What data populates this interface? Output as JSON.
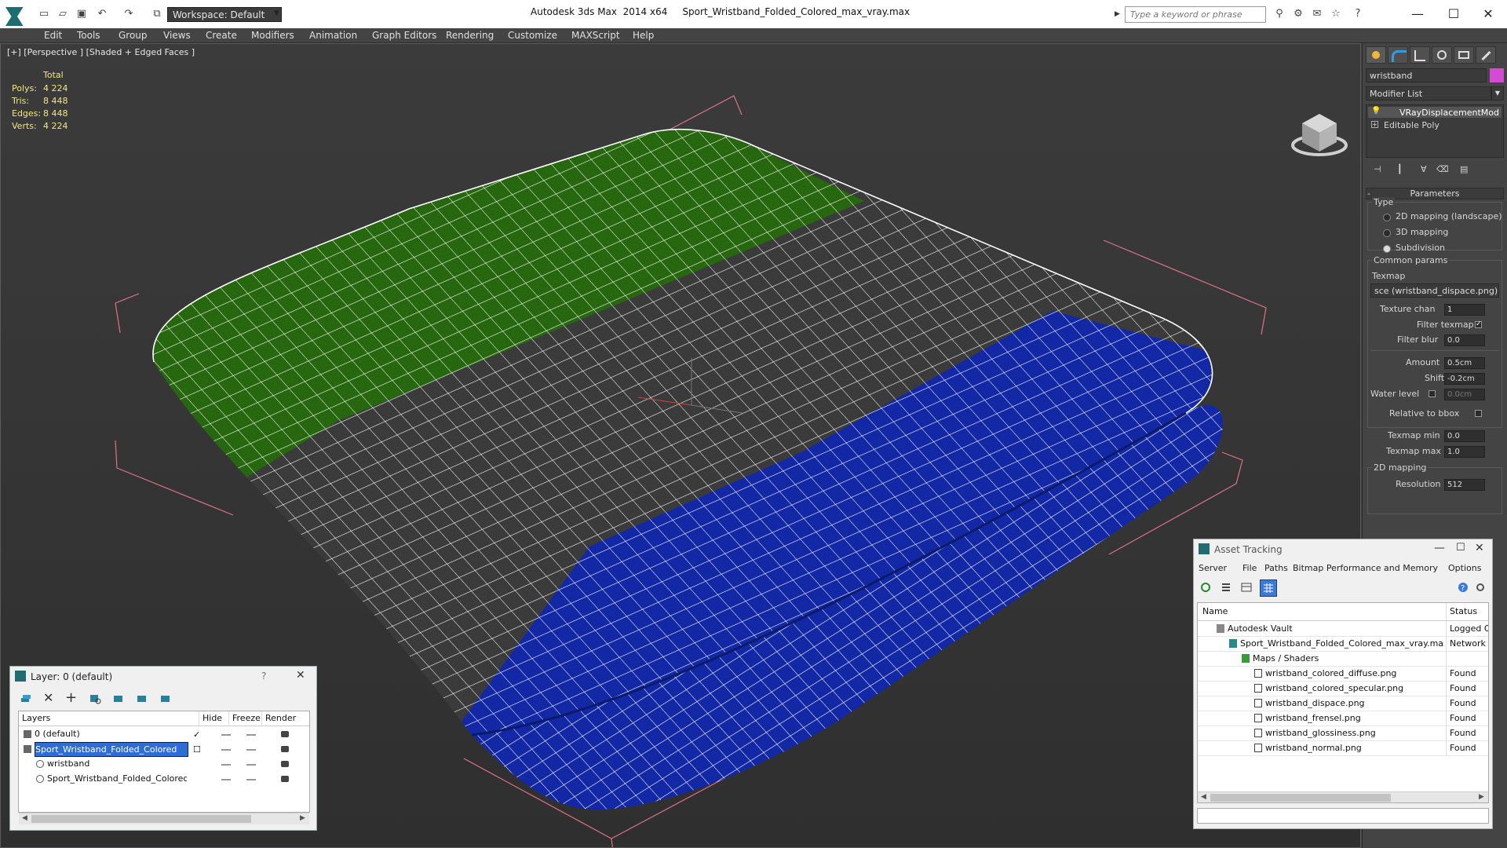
{
  "titlebar": {
    "workspace": "Workspace: Default",
    "app_name": "Autodesk 3ds Max  2014 x64",
    "file_name": "Sport_Wristband_Folded_Colored_max_vray.max",
    "search_placeholder": "Type a keyword or phrase"
  },
  "menu": [
    "Edit",
    "Tools",
    "Group",
    "Views",
    "Create",
    "Modifiers",
    "Animation",
    "Graph Editors",
    "Rendering",
    "Customize",
    "MAXScript",
    "Help"
  ],
  "viewport": {
    "label": "[+] [Perspective ] [Shaded + Edged Faces ]",
    "stats": {
      "header": "Total",
      "rows": [
        {
          "label": "Polys:",
          "value": "4 224"
        },
        {
          "label": "Tris:",
          "value": "8 448"
        },
        {
          "label": "Edges:",
          "value": "8 448"
        },
        {
          "label": "Verts:",
          "value": "4 224"
        }
      ]
    },
    "colors": {
      "green": "#2f7d12",
      "gray": "#474747",
      "blue": "#1730c8",
      "wire": "#ffffff",
      "bbox": "#e0708a"
    }
  },
  "command_panel": {
    "object_name": "wristband",
    "object_color": "#d34ad3",
    "modifier_list_label": "Modifier List",
    "modifier_stack": [
      "VRayDisplacementMod",
      "Editable Poly"
    ],
    "parameters_title": "Parameters",
    "type_label": "Type",
    "type_options": [
      {
        "label": "2D mapping (landscape)",
        "selected": false
      },
      {
        "label": "3D mapping",
        "selected": false
      },
      {
        "label": "Subdivision",
        "selected": true
      }
    ],
    "common_params_label": "Common params",
    "texmap_label": "Texmap",
    "texmap_value": "sce (wristband_dispace.png)",
    "texture_chan_label": "Texture chan",
    "texture_chan_value": "1",
    "filter_texmap_label": "Filter texmap",
    "filter_texmap_checked": true,
    "filter_blur_label": "Filter blur",
    "filter_blur_value": "0.0",
    "amount_label": "Amount",
    "amount_value": "0.5cm",
    "shift_label": "Shift",
    "shift_value": "-0.2cm",
    "water_level_label": "Water level",
    "water_level_value": "0.0cm",
    "relative_bbox_label": "Relative to bbox",
    "texmap_min_label": "Texmap min",
    "texmap_min_value": "0.0",
    "texmap_max_label": "Texmap max",
    "texmap_max_value": "1.0",
    "mapping_2d_label": "2D mapping",
    "resolution_label": "Resolution",
    "resolution_value": "512"
  },
  "layer_window": {
    "title": "Layer: 0 (default)",
    "help": "?",
    "columns": [
      "Layers",
      "Hide",
      "Freeze",
      "Render"
    ],
    "rows": [
      {
        "name": "0 (default)",
        "indent": 0,
        "selected": false
      },
      {
        "name": "Sport_Wristband_Folded_Colored",
        "indent": 0,
        "selected": true
      },
      {
        "name": "wristband",
        "indent": 1,
        "selected": false
      },
      {
        "name": "Sport_Wristband_Folded_Colored",
        "indent": 1,
        "selected": false
      }
    ]
  },
  "asset_window": {
    "title": "Asset Tracking",
    "menu": [
      "Server",
      "File",
      "Paths",
      "Bitmap Performance and Memory",
      "Options"
    ],
    "columns": [
      "Name",
      "Status"
    ],
    "rows": [
      {
        "name": "Autodesk Vault",
        "status": "Logged Ou",
        "indent": 0
      },
      {
        "name": "Sport_Wristband_Folded_Colored_max_vray.max",
        "status": "Network P",
        "indent": 1
      },
      {
        "name": "Maps / Shaders",
        "status": "",
        "indent": 2
      },
      {
        "name": "wristband_colored_diffuse.png",
        "status": "Found",
        "indent": 3
      },
      {
        "name": "wristband_colored_specular.png",
        "status": "Found",
        "indent": 3
      },
      {
        "name": "wristband_dispace.png",
        "status": "Found",
        "indent": 3
      },
      {
        "name": "wristband_frensel.png",
        "status": "Found",
        "indent": 3
      },
      {
        "name": "wristband_glossiness.png",
        "status": "Found",
        "indent": 3
      },
      {
        "name": "wristband_normal.png",
        "status": "Found",
        "indent": 3
      }
    ]
  }
}
